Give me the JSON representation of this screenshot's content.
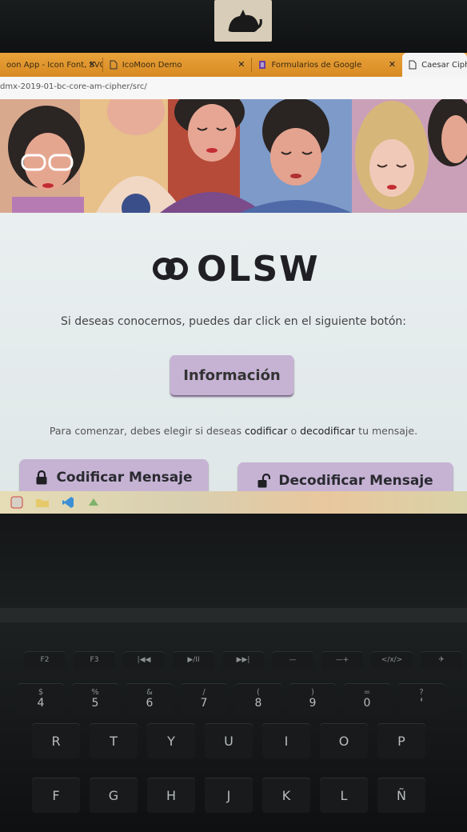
{
  "browser": {
    "tabs": [
      {
        "label": "oon App - Icon Font, SVG",
        "close": "✕",
        "icon": "favicon-icon"
      },
      {
        "label": "IcoMoon Demo",
        "close": "✕",
        "icon": "page-icon"
      },
      {
        "label": "Formularios de Google",
        "close": "✕",
        "icon": "forms-icon"
      },
      {
        "label": "Caesar Ciph",
        "close": "",
        "icon": "page-icon"
      }
    ],
    "url": "dmx-2019-01-bc-core-am-cipher/src/"
  },
  "page": {
    "logo_text": "OLSW",
    "intro_text": "Si deseas conocernos, puedes dar click en el siguiente botón:",
    "info_button": "Información",
    "instructions": {
      "part1": "Para comenzar, debes elegir si deseas ",
      "encode_word": "codificar",
      "part2": " o ",
      "decode_word": "decodificar",
      "part3": " tu mensaje."
    },
    "encode_button": "Codificar Mensaje",
    "decode_button": "Decodificar Mensaje"
  },
  "keyboard": {
    "fn_row": [
      "F2",
      "F3",
      "|◀◀",
      "▶/II",
      "▶▶|",
      "—",
      "—+",
      "</x/>",
      "✈"
    ],
    "num_row": [
      {
        "top": "$",
        "main": "4"
      },
      {
        "top": "%",
        "main": "5"
      },
      {
        "top": "&",
        "main": "6"
      },
      {
        "top": "/",
        "main": "7"
      },
      {
        "top": "(",
        "main": "8"
      },
      {
        "top": ")",
        "main": "9"
      },
      {
        "top": "=",
        "main": "0"
      },
      {
        "top": "?",
        "main": "'"
      }
    ],
    "row2": [
      "R",
      "T",
      "Y",
      "U",
      "I",
      "O",
      "P"
    ],
    "row3": [
      "F",
      "G",
      "H",
      "J",
      "K",
      "L",
      "Ñ"
    ]
  },
  "colors": {
    "tab_bar": "#e09a30",
    "button_bg": "#c6b3d4",
    "button_shadow": "#6d5a7a",
    "logo": "#1f1f24"
  }
}
